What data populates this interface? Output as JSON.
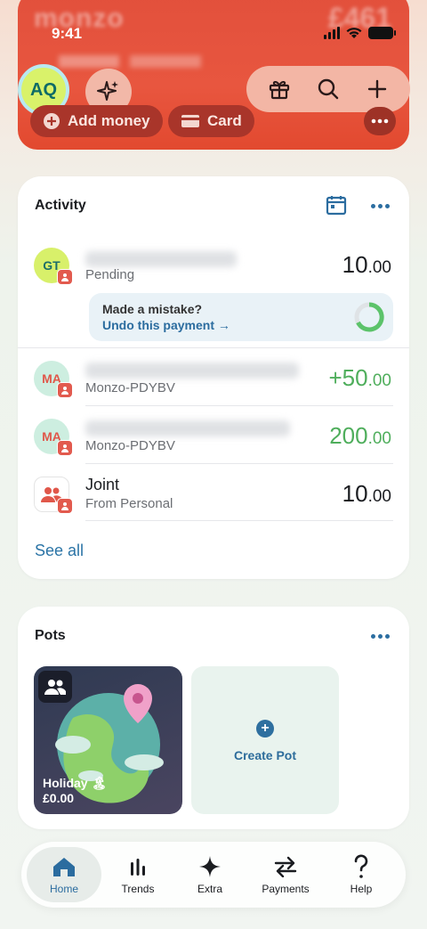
{
  "status_bar": {
    "time": "9:41"
  },
  "account_card": {
    "brand": "monzo",
    "balance_blurred": "£461",
    "add_money_label": "Add money",
    "card_label": "Card"
  },
  "header": {
    "avatar_initials": "AQ"
  },
  "activity": {
    "title": "Activity",
    "transactions": [
      {
        "initials": "GT",
        "subtitle": "Pending",
        "amount_main": "10",
        "amount_dec": ".00"
      },
      {
        "initials": "MA",
        "subtitle": "Monzo-PDYBV",
        "amount_main": "+50",
        "amount_dec": ".00"
      },
      {
        "initials": "MA",
        "subtitle": "Monzo-PDYBV",
        "amount_main": "200",
        "amount_dec": ".00"
      },
      {
        "name": "Joint",
        "subtitle": "From Personal",
        "amount_main": "10",
        "amount_dec": ".00"
      }
    ],
    "undo": {
      "title": "Made a mistake?",
      "link": "Undo this payment →"
    },
    "see_all": "See all"
  },
  "pots": {
    "title": "Pots",
    "items": [
      {
        "name": "Holiday 🏝",
        "balance": "£0.00"
      }
    ],
    "create_label": "Create Pot"
  },
  "nav": {
    "items": [
      {
        "label": "Home",
        "icon": "home-icon"
      },
      {
        "label": "Trends",
        "icon": "bar-chart-icon"
      },
      {
        "label": "Extra",
        "icon": "sparkle-icon"
      },
      {
        "label": "Payments",
        "icon": "transfer-arrows-icon"
      },
      {
        "label": "Help",
        "icon": "question-icon"
      }
    ]
  },
  "colors": {
    "brand_red": "#e2503c",
    "accent_blue": "#2b6c9f",
    "positive_green": "#4fae5c"
  }
}
